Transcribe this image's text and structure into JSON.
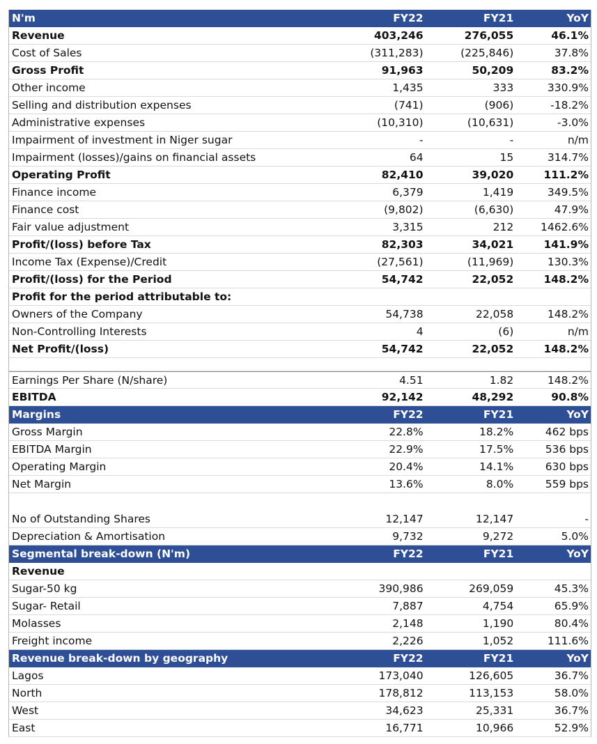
{
  "rows": [
    {
      "type": "hdr",
      "label": "N'm",
      "fy22": "FY22",
      "fy21": "FY21",
      "yoy": "YoY"
    },
    {
      "type": "bold",
      "label": "Revenue",
      "fy22": "403,246",
      "fy21": "276,055",
      "yoy": "46.1%"
    },
    {
      "type": "norm",
      "label": "Cost of Sales",
      "fy22": "(311,283)",
      "fy21": "(225,846)",
      "yoy": "37.8%"
    },
    {
      "type": "bold",
      "label": "Gross Profit",
      "fy22": "91,963",
      "fy21": "50,209",
      "yoy": "83.2%"
    },
    {
      "type": "norm",
      "label": "Other income",
      "fy22": "1,435",
      "fy21": "333",
      "yoy": "330.9%"
    },
    {
      "type": "norm",
      "label": "Selling and distribution expenses",
      "fy22": "(741)",
      "fy21": "(906)",
      "yoy": "-18.2%"
    },
    {
      "type": "norm",
      "label": "Administrative expenses",
      "fy22": "(10,310)",
      "fy21": "(10,631)",
      "yoy": "-3.0%"
    },
    {
      "type": "norm",
      "label": "Impairment of investment in Niger sugar",
      "fy22": "-",
      "fy21": "-",
      "yoy": "n/m"
    },
    {
      "type": "norm",
      "label": "Impairment (losses)/gains on financial assets",
      "fy22": "64",
      "fy21": "15",
      "yoy": "314.7%"
    },
    {
      "type": "bold",
      "label": "Operating Profit",
      "fy22": "82,410",
      "fy21": "39,020",
      "yoy": "111.2%"
    },
    {
      "type": "norm",
      "label": "Finance income",
      "fy22": "6,379",
      "fy21": "1,419",
      "yoy": "349.5%"
    },
    {
      "type": "norm",
      "label": "Finance cost",
      "fy22": "(9,802)",
      "fy21": "(6,630)",
      "yoy": "47.9%"
    },
    {
      "type": "norm",
      "label": "Fair value adjustment",
      "fy22": "3,315",
      "fy21": "212",
      "yoy": "1462.6%"
    },
    {
      "type": "bold",
      "label": "Profit/(loss) before Tax",
      "fy22": "82,303",
      "fy21": "34,021",
      "yoy": "141.9%"
    },
    {
      "type": "norm",
      "label": "Income Tax (Expense)/Credit",
      "fy22": "(27,561)",
      "fy21": "(11,969)",
      "yoy": "130.3%"
    },
    {
      "type": "bold",
      "label": "Profit/(loss) for the Period",
      "fy22": "54,742",
      "fy21": "22,052",
      "yoy": "148.2%"
    },
    {
      "type": "bold",
      "label": "Profit for the period attributable to:",
      "fy22": "",
      "fy21": "",
      "yoy": ""
    },
    {
      "type": "norm",
      "label": "Owners of the Company",
      "fy22": "54,738",
      "fy21": "22,058",
      "yoy": "148.2%"
    },
    {
      "type": "norm",
      "label": "Non-Controlling Interests",
      "fy22": "4",
      "fy21": "(6)",
      "yoy": "n/m"
    },
    {
      "type": "bold",
      "label": "Net Profit/(loss)",
      "fy22": "54,742",
      "fy21": "22,052",
      "yoy": "148.2%"
    },
    {
      "type": "gap",
      "label": "",
      "fy22": "",
      "fy21": "",
      "yoy": ""
    },
    {
      "type": "norm",
      "label": "Earnings Per Share (N/share)",
      "fy22": "4.51",
      "fy21": "1.82",
      "yoy": "148.2%"
    },
    {
      "type": "bold",
      "label": "EBITDA",
      "fy22": "92,142",
      "fy21": "48,292",
      "yoy": "90.8%"
    },
    {
      "type": "hdr",
      "label": "Margins",
      "fy22": "FY22",
      "fy21": "FY21",
      "yoy": "YoY"
    },
    {
      "type": "norm",
      "label": "Gross Margin",
      "fy22": "22.8%",
      "fy21": "18.2%",
      "yoy": "462 bps"
    },
    {
      "type": "norm",
      "label": "EBITDA Margin",
      "fy22": "22.9%",
      "fy21": "17.5%",
      "yoy": "536 bps"
    },
    {
      "type": "norm",
      "label": "Operating Margin",
      "fy22": "20.4%",
      "fy21": "14.1%",
      "yoy": "630 bps"
    },
    {
      "type": "norm",
      "label": "Net Margin",
      "fy22": "13.6%",
      "fy21": "8.0%",
      "yoy": "559 bps"
    },
    {
      "type": "gap2",
      "label": "",
      "fy22": "",
      "fy21": "",
      "yoy": ""
    },
    {
      "type": "norm",
      "label": "No of Outstanding Shares",
      "fy22": "12,147",
      "fy21": "12,147",
      "yoy": "-"
    },
    {
      "type": "norm",
      "label": "Depreciation & Amortisation",
      "fy22": "9,732",
      "fy21": "9,272",
      "yoy": "5.0%"
    },
    {
      "type": "hdr",
      "label": "Segmental break-down (N'm)",
      "fy22": "FY22",
      "fy21": "FY21",
      "yoy": "YoY"
    },
    {
      "type": "bold",
      "label": "Revenue",
      "fy22": "",
      "fy21": "",
      "yoy": ""
    },
    {
      "type": "norm",
      "label": "Sugar-50 kg",
      "fy22": "390,986",
      "fy21": "269,059",
      "yoy": "45.3%"
    },
    {
      "type": "norm",
      "label": "Sugar- Retail",
      "fy22": "7,887",
      "fy21": "4,754",
      "yoy": "65.9%"
    },
    {
      "type": "norm",
      "label": "Molasses",
      "fy22": "2,148",
      "fy21": "1,190",
      "yoy": "80.4%"
    },
    {
      "type": "norm",
      "label": "Freight income",
      "fy22": "2,226",
      "fy21": "1,052",
      "yoy": "111.6%"
    },
    {
      "type": "hdr",
      "label": "Revenue break-down by geography",
      "fy22": "FY22",
      "fy21": "FY21",
      "yoy": "YoY"
    },
    {
      "type": "norm",
      "label": "Lagos",
      "fy22": "173,040",
      "fy21": "126,605",
      "yoy": "36.7%"
    },
    {
      "type": "norm",
      "label": "North",
      "fy22": "178,812",
      "fy21": "113,153",
      "yoy": "58.0%"
    },
    {
      "type": "norm",
      "label": "West",
      "fy22": "34,623",
      "fy21": "25,331",
      "yoy": "36.7%"
    },
    {
      "type": "norm",
      "label": "East",
      "fy22": "16,771",
      "fy21": "10,966",
      "yoy": "52.9%"
    }
  ]
}
